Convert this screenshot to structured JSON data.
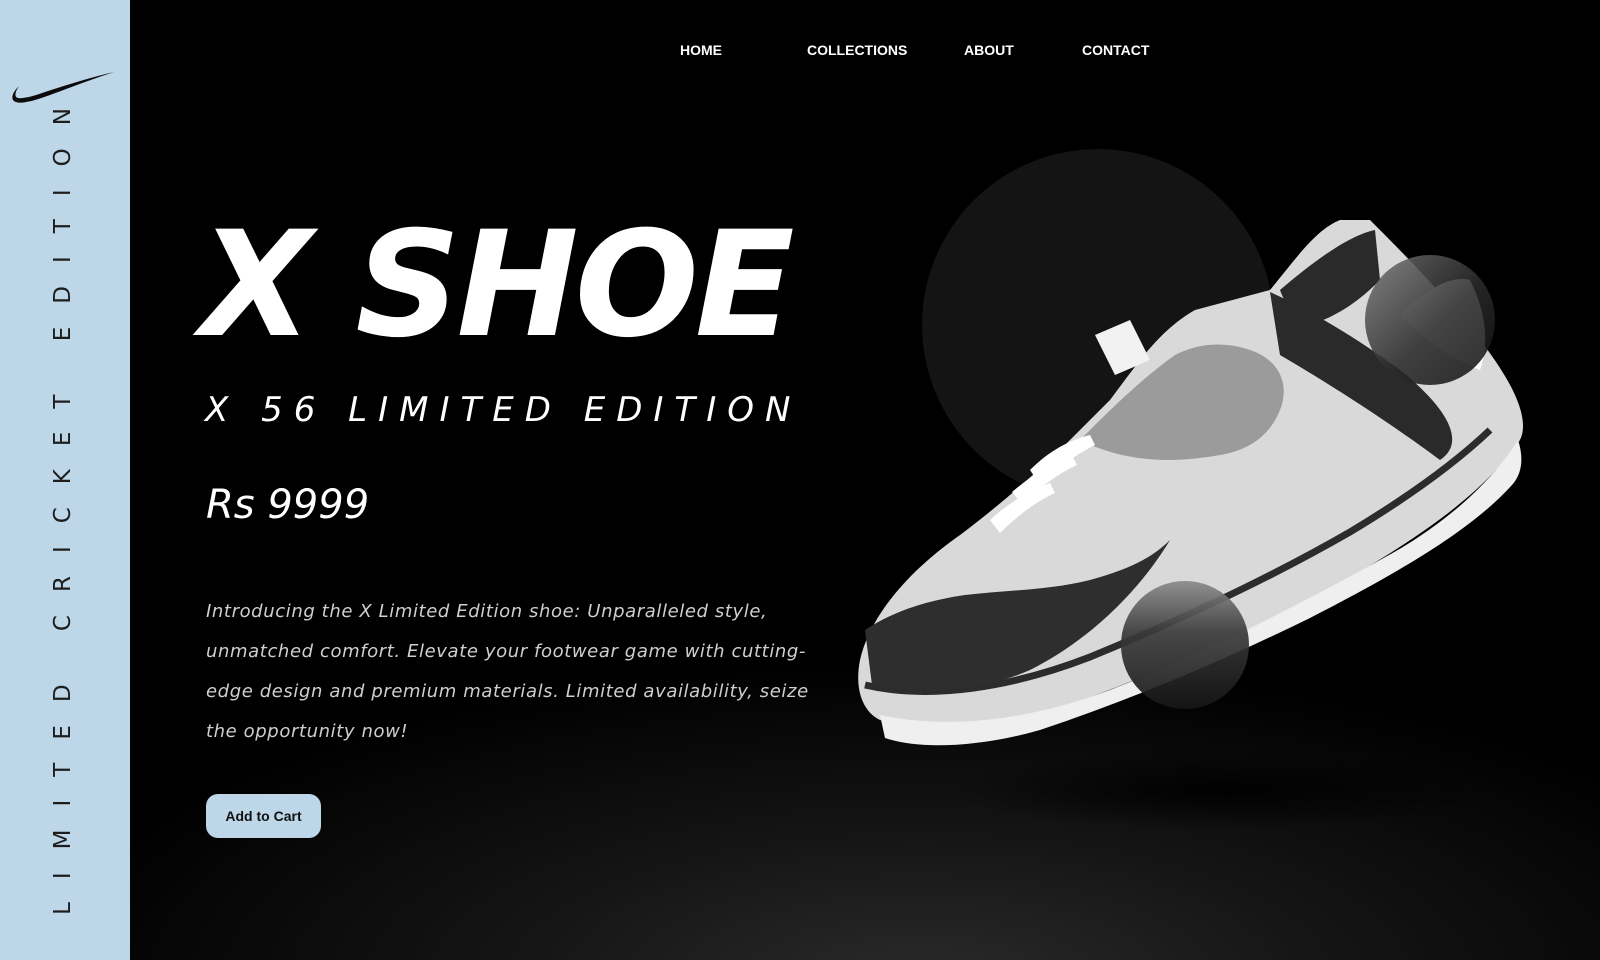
{
  "brand": {
    "logo_icon": "swoosh-logo-icon",
    "tagline": "LIMITED CRICKET EDITION"
  },
  "nav": {
    "items": [
      {
        "label": "HOME"
      },
      {
        "label": "COLLECTIONS"
      },
      {
        "label": "ABOUT"
      },
      {
        "label": "CONTACT"
      }
    ]
  },
  "hero": {
    "title": "X SHOE",
    "subtitle": "X 56 LIMITED EDITION",
    "price": "Rs  9999",
    "description": "Introducing the X Limited Edition shoe: Unparalleled style, unmatched comfort. Elevate your footwear game with cutting-edge design and premium materials. Limited availability, seize the opportunity now!",
    "cta_label": "Add to Cart",
    "image_icon": "sneaker-image"
  },
  "colors": {
    "background": "#000000",
    "sidebar": "#bdd6e8",
    "accent": "#bdd6e8",
    "text": "#ffffff"
  }
}
